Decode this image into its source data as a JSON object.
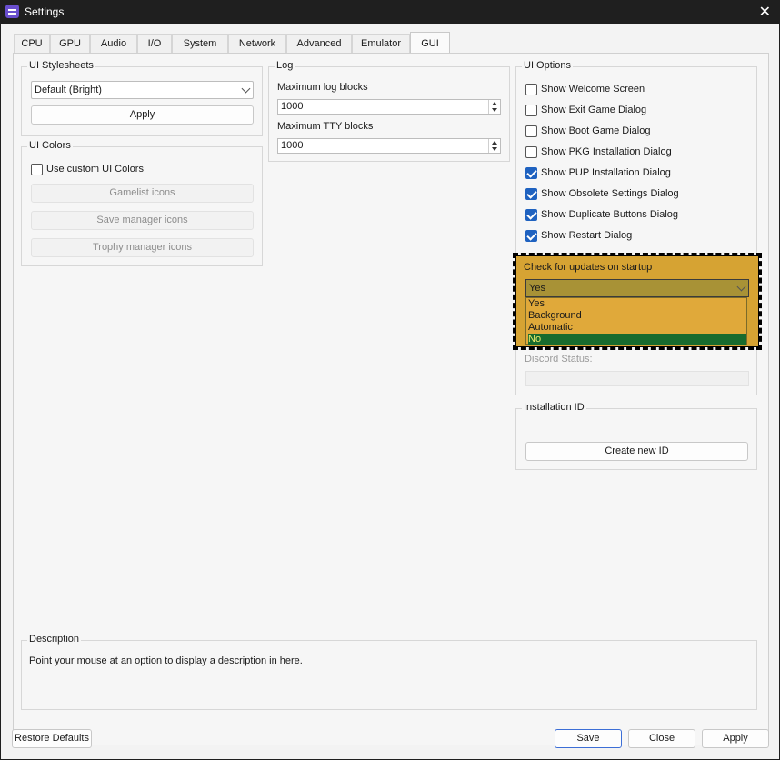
{
  "window": {
    "title": "Settings"
  },
  "tabs": [
    "CPU",
    "GPU",
    "Audio",
    "I/O",
    "System",
    "Network",
    "Advanced",
    "Emulator",
    "GUI"
  ],
  "active_tab": "GUI",
  "ui_stylesheets": {
    "title": "UI Stylesheets",
    "selected": "Default (Bright)",
    "apply_label": "Apply"
  },
  "ui_colors": {
    "title": "UI Colors",
    "custom_label": "Use custom UI Colors",
    "custom_checked": false,
    "gamelist_label": "Gamelist icons",
    "save_manager_label": "Save manager icons",
    "trophy_manager_label": "Trophy manager icons"
  },
  "log": {
    "title": "Log",
    "max_log_label": "Maximum log blocks",
    "max_log_value": "1000",
    "max_tty_label": "Maximum TTY blocks",
    "max_tty_value": "1000"
  },
  "ui_options": {
    "title": "UI Options",
    "items": [
      {
        "label": "Show Welcome Screen",
        "checked": false
      },
      {
        "label": "Show Exit Game Dialog",
        "checked": false
      },
      {
        "label": "Show Boot Game Dialog",
        "checked": false
      },
      {
        "label": "Show PKG Installation Dialog",
        "checked": false
      },
      {
        "label": "Show PUP Installation Dialog",
        "checked": true
      },
      {
        "label": "Show Obsolete Settings Dialog",
        "checked": true
      },
      {
        "label": "Show Duplicate Buttons Dialog",
        "checked": true
      },
      {
        "label": "Show Restart Dialog",
        "checked": true
      }
    ]
  },
  "updates": {
    "title": "Check for updates on startup",
    "selected": "Yes",
    "options": [
      "Yes",
      "Background",
      "Automatic",
      "No"
    ],
    "highlighted": "No"
  },
  "discord": {
    "status_label": "Discord Status:"
  },
  "installation_id": {
    "title": "Installation ID",
    "button_label": "Create new ID"
  },
  "description": {
    "title": "Description",
    "text": "Point your mouse at an option to display a description in here."
  },
  "footer": {
    "restore_label": "Restore Defaults",
    "save_label": "Save",
    "close_label": "Close",
    "apply_label": "Apply"
  },
  "colors": {
    "checkbox_accent": "#1f62c0",
    "highlight_box": "#d6a333",
    "selected_option_bg": "#186b2e"
  }
}
